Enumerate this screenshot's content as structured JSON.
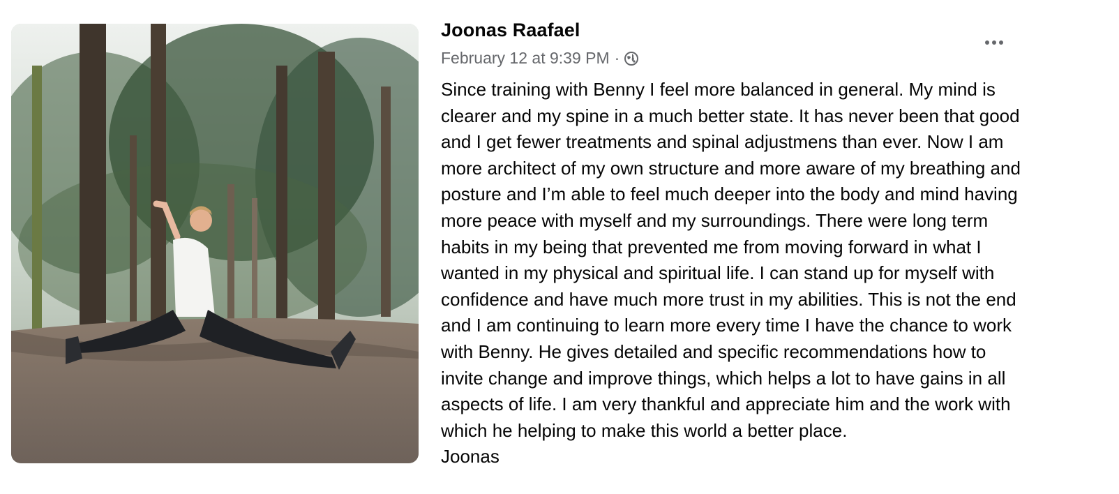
{
  "post": {
    "author": "Joonas Raafael",
    "timestamp": "February 12 at 9:39 PM",
    "separator": "·",
    "privacy_icon": "globe-icon",
    "more_icon": "more-options-icon",
    "photo_icon": "photo-person-doing-splits-in-forest",
    "body_lines": [
      "Since training with Benny I feel more balanced in general. My mind is",
      "clearer and my spine in a much better state. It has never been that good",
      "and I get fewer treatments and spinal adjustmens than ever. Now I am",
      "more architect of my own structure and more aware of my breathing and",
      "posture and I’m able to feel much deeper into the body and mind having",
      "more peace with myself and my surroundings. There were long term",
      "habits in my being that prevented me from moving forward in what I",
      "wanted in my physical and spiritual life. I can stand up for myself with",
      "confidence and have much more trust in my abilities. This is not the end",
      "and I am continuing to learn more every time I have the chance to work",
      "with Benny. He gives detailed and specific recommendations how to",
      "invite change and improve things, which helps a lot to have gains in all",
      "aspects of life. I am very thankful and appreciate him and the work with",
      "which he helping to make this world a better place.",
      "Joonas"
    ]
  },
  "colors": {
    "text_primary": "#050505",
    "text_secondary": "#65676b",
    "background": "#ffffff"
  }
}
